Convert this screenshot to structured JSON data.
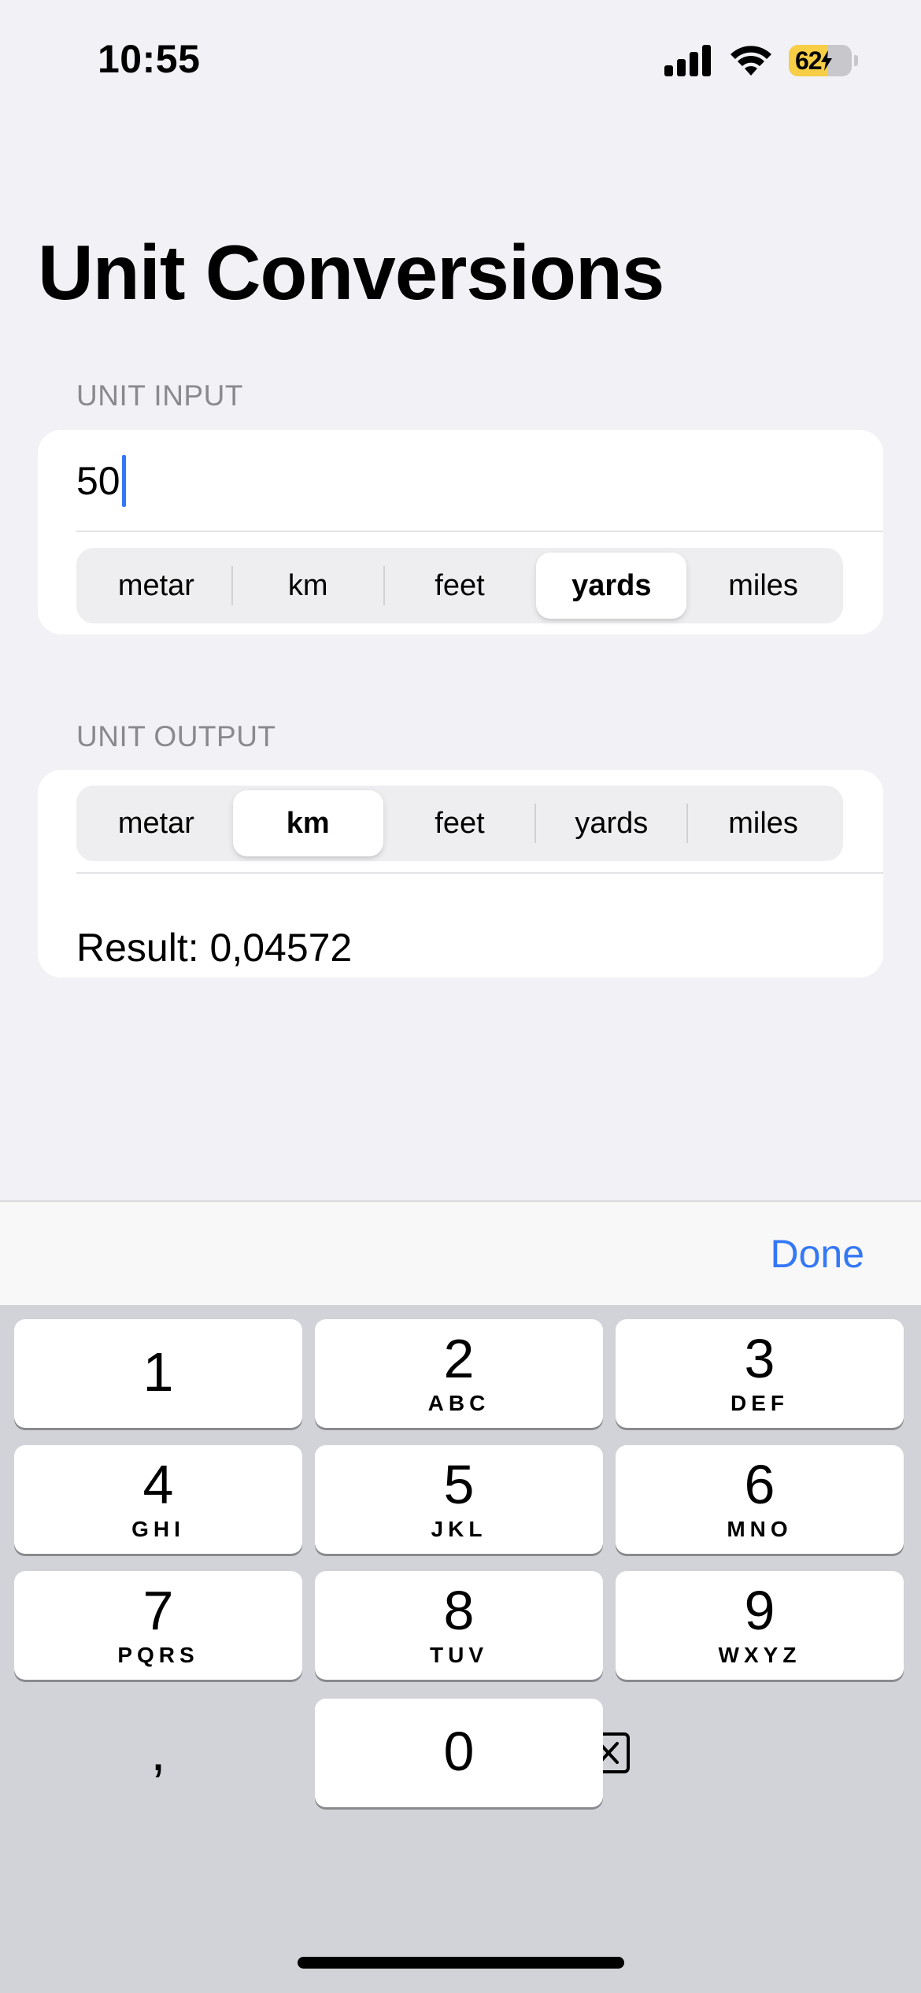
{
  "status_bar": {
    "time": "10:55",
    "battery_level": "62",
    "battery_fraction": 0.62,
    "battery_color": "#F7CE46"
  },
  "title": "Unit Conversions",
  "input_section": {
    "header": "UNIT INPUT",
    "value": "50",
    "units": [
      "metar",
      "km",
      "feet",
      "yards",
      "miles"
    ],
    "selected_unit": "yards"
  },
  "output_section": {
    "header": "UNIT OUTPUT",
    "units": [
      "metar",
      "km",
      "feet",
      "yards",
      "miles"
    ],
    "selected_unit": "km",
    "result": "Result: 0,04572"
  },
  "keyboard": {
    "done_label": "Done",
    "keys": [
      {
        "num": "1",
        "letters": ""
      },
      {
        "num": "2",
        "letters": "ABC"
      },
      {
        "num": "3",
        "letters": "DEF"
      },
      {
        "num": "4",
        "letters": "GHI"
      },
      {
        "num": "5",
        "letters": "JKL"
      },
      {
        "num": "6",
        "letters": "MNO"
      },
      {
        "num": "7",
        "letters": "PQRS"
      },
      {
        "num": "8",
        "letters": "TUV"
      },
      {
        "num": "9",
        "letters": "WXYZ"
      },
      {
        "num": ",",
        "letters": ""
      },
      {
        "num": "0",
        "letters": ""
      }
    ],
    "accent_color": "#3478F6"
  }
}
